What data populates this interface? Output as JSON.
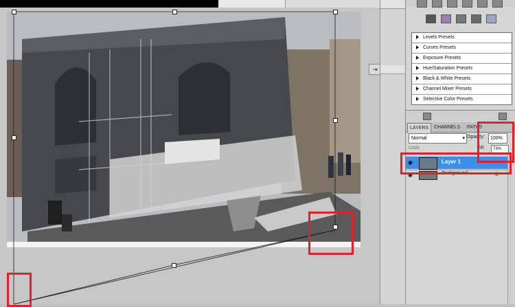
{
  "presets": [
    "Levels Presets",
    "Curves Presets",
    "Exposure Presets",
    "Hue/Saturation Presets",
    "Black & White Presets",
    "Channel Mixer Presets",
    "Selective Color Presets"
  ],
  "layers_panel": {
    "tabs": [
      "LAYERS",
      "CHANNELS",
      "PATHS"
    ],
    "blend_mode": "Normal",
    "opacity_label": "Opacity:",
    "opacity_value": "100%",
    "lock_label": "Lock:",
    "fill_label": "Fill:",
    "fill_value": "73%",
    "layers": [
      {
        "name": "Layer 1",
        "selected": true
      },
      {
        "name": "Background",
        "selected": false
      }
    ]
  },
  "icons": [
    "eye-icon",
    "lock-icon",
    "panel-collapse-icon",
    "preset-expand-icon"
  ],
  "colors": {
    "selection_blue": "#3c8ee8",
    "highlight_red": "#e2202a",
    "panel_bg": "#d6d6d6"
  }
}
